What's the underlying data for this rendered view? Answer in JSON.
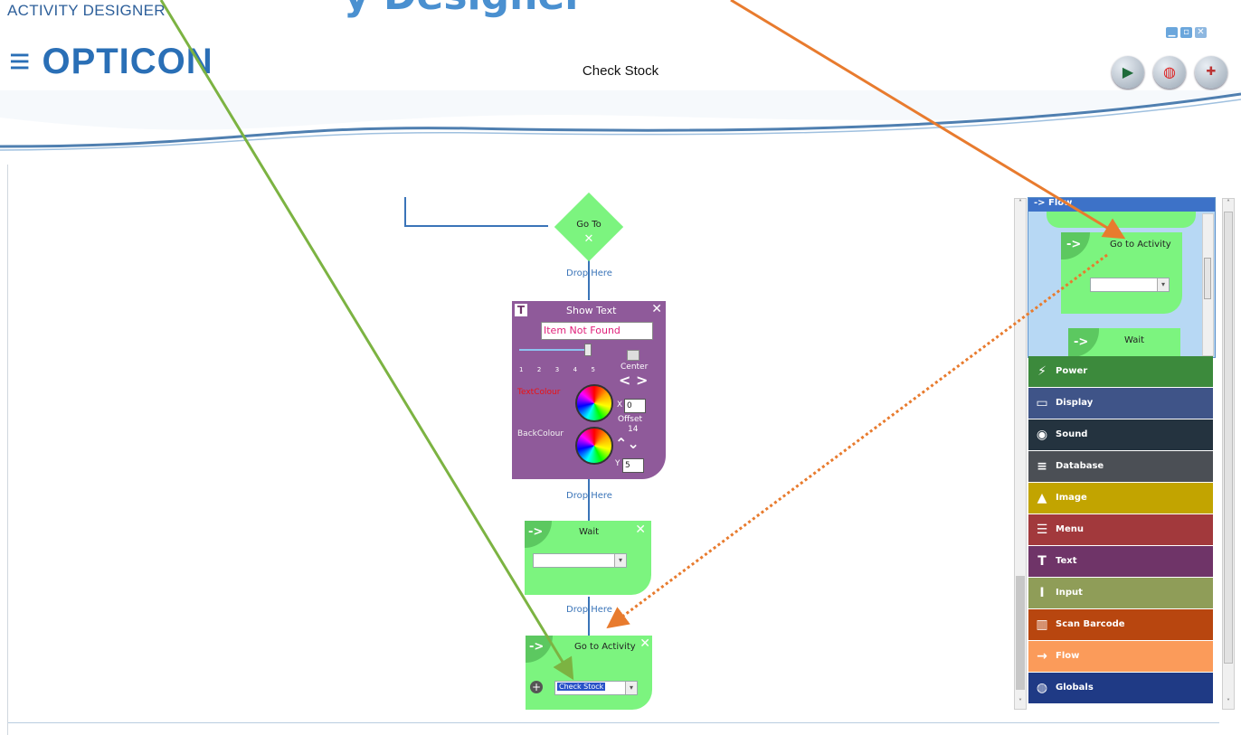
{
  "header": {
    "app_title": "ACTIVITY DESIGNER",
    "top_clip": "y Designer",
    "logo": "≡ OPTICON",
    "doc_title": "Check Stock"
  },
  "canvas": {
    "goto_node": {
      "label": "Go To"
    },
    "drop_here": [
      "Drop Here",
      "Drop Here",
      "Drop Here"
    ],
    "show_text": {
      "title": "Show Text",
      "text_value": "Item Not Found",
      "scale_labels": [
        "1",
        "2",
        "3",
        "4",
        "5"
      ],
      "slider_value": 5,
      "center_label": "Center",
      "text_colour_label": "TextColour",
      "back_colour_label": "BackColour",
      "x_label": "X",
      "x_value": "0",
      "offset_label": "Offset",
      "offset_value": "14",
      "y_label": "Y",
      "y_value": "5"
    },
    "wait_block": {
      "title": "Wait",
      "select_value": ""
    },
    "goto_activity_block": {
      "title": "Go to Activity",
      "select_value": "Check Stock"
    }
  },
  "palette": {
    "open_category": "Flow",
    "flow_items": [
      {
        "label": "Go to Activity",
        "select_value": ""
      },
      {
        "label": "Wait"
      }
    ],
    "categories": [
      {
        "label": "Power",
        "color": "#3c8a3c",
        "icon": "power-icon",
        "glyph": "⚡"
      },
      {
        "label": "Display",
        "color": "#3f5488",
        "icon": "display-icon",
        "glyph": "▭"
      },
      {
        "label": "Sound",
        "color": "#24333f",
        "icon": "sound-icon",
        "glyph": "◉"
      },
      {
        "label": "Database",
        "color": "#4b4f55",
        "icon": "database-icon",
        "glyph": "≡"
      },
      {
        "label": "Image",
        "color": "#c2a400",
        "icon": "image-icon",
        "glyph": "▲"
      },
      {
        "label": "Menu",
        "color": "#a2393c",
        "icon": "menu-icon",
        "glyph": "☰"
      },
      {
        "label": "Text",
        "color": "#6f3468",
        "icon": "text-icon",
        "glyph": "T"
      },
      {
        "label": "Input",
        "color": "#8f9d58",
        "icon": "input-icon",
        "glyph": "I"
      },
      {
        "label": "Scan Barcode",
        "color": "#b8460f",
        "icon": "barcode-icon",
        "glyph": "▥"
      },
      {
        "label": "Flow",
        "color": "#fb9b5a",
        "icon": "flow-icon",
        "glyph": "→"
      },
      {
        "label": "Globals",
        "color": "#1f3a85",
        "icon": "globe-icon",
        "glyph": "◍"
      }
    ]
  },
  "colors": {
    "accent": "#3a74b8",
    "flow_green": "#7cf47f",
    "text_purple": "#8f5a9a",
    "annotation_green": "#7cb342",
    "annotation_orange": "#e87b2e"
  }
}
